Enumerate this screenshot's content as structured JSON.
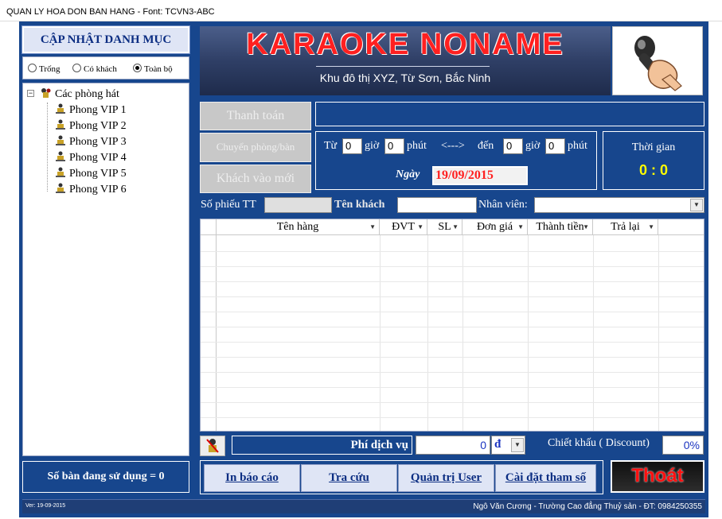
{
  "window": {
    "title": "QUAN LY HOA DON BAN HANG - Font: TCVN3-ABC"
  },
  "sidebar": {
    "update_button": "CẬP NHẬT DANH MỤC",
    "filter_options": [
      {
        "label": "Trống",
        "selected": false
      },
      {
        "label": "Có khách",
        "selected": false
      },
      {
        "label": "Toàn bộ",
        "selected": true
      }
    ],
    "tree": {
      "toggle": "−",
      "root": "Các phòng hát",
      "rooms": [
        "Phong VIP 1",
        "Phong VIP 2",
        "Phong VIP 3",
        "Phong VIP 4",
        "Phong VIP 5",
        "Phong VIP 6"
      ]
    },
    "tables_in_use": "Số bàn đang sử dụng = 0"
  },
  "banner": {
    "title": "KARAOKE NONAME",
    "subtitle": "Khu đô thị XYZ, Từ Sơn, Bắc Ninh",
    "title_color": "#ff2020"
  },
  "actions": {
    "pay": "Thanh toán",
    "move_room": "Chuyển phòng/bàn",
    "new_guest": "Khách vào mới"
  },
  "time_range": {
    "from_label": "Từ",
    "from_hour": "0",
    "hour_label": "giờ",
    "from_minute": "0",
    "minute_label": "phút",
    "arrow": "<--->",
    "to_label": "đến",
    "to_hour": "0",
    "to_minute": "0",
    "date_label": "Ngày",
    "date_value": "19/09/2015"
  },
  "clock": {
    "label": "Thời gian",
    "value": "0 : 0"
  },
  "invoice": {
    "number_label": "Số phiếu TT",
    "number_value": "",
    "guest_label": "Tên khách",
    "guest_value": "",
    "staff_label": "Nhân viên:",
    "staff_value": ""
  },
  "grid": {
    "columns": [
      "Tên hàng",
      "ĐVT",
      "SL",
      "Đơn giá",
      "Thành tiền",
      "Trả lại"
    ],
    "rows": []
  },
  "service": {
    "fee_label": "Phí dịch vụ",
    "fee_value": "0",
    "unit": "đ",
    "discount_label": "Chiết khấu ( Discount)",
    "discount_value": "0%"
  },
  "bottom_buttons": [
    "In báo cáo",
    "Tra cứu",
    "Quản trị User",
    "Cài đặt tham số"
  ],
  "exit_button": "Thoát",
  "footer": {
    "version": "Ver: 19-09-2015",
    "credit": "Ngô Văn Cương - Trường Cao đẳng Thuỷ sản - ĐT: 0984250355"
  },
  "colors": {
    "background": "#17468d",
    "accent_yellow": "#ffff00",
    "accent_red": "#ff2020"
  }
}
